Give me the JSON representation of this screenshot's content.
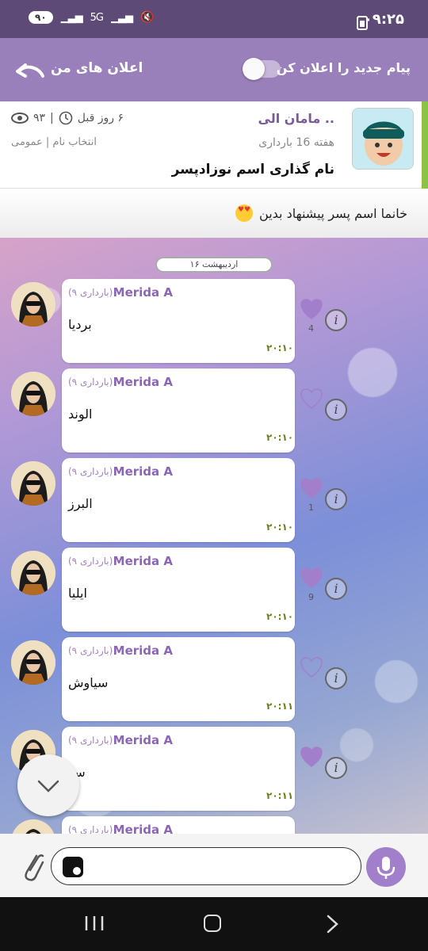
{
  "status_bar": {
    "time": "۰۹:۲۵",
    "left_pill": "۹۰",
    "network": "5G"
  },
  "header": {
    "my_ads": "اعلان های من",
    "notify_new": "پیام جدید را اعلان کن",
    "notify_toggle_on": false
  },
  "post": {
    "author": "مامان الی ..",
    "week": "هفته 16 بارداری",
    "title": "نام گذاری اسم نوزادپسر",
    "time_ago": "۶ روز قبل",
    "views": "۹۳",
    "category": "انتخاب نام | عمومی",
    "question": "خانما اسم پسر پیشنهاد بدین"
  },
  "date_separator": "۱۶ اردیبهشت",
  "messages": [
    {
      "name": "Merida A",
      "tag": "(۹ بارداری)",
      "text": "بردیا",
      "time": "۲۰:۱۰",
      "liked": true,
      "likes": "4"
    },
    {
      "name": "Merida A",
      "tag": "(۹ بارداری)",
      "text": "الوند",
      "time": "۲۰:۱۰",
      "liked": false,
      "likes": ""
    },
    {
      "name": "Merida A",
      "tag": "(۹ بارداری)",
      "text": "البرز",
      "time": "۲۰:۱۰",
      "liked": true,
      "likes": "1"
    },
    {
      "name": "Merida A",
      "tag": "(۹ بارداری)",
      "text": "ایلیا",
      "time": "۲۰:۱۰",
      "liked": true,
      "likes": "9"
    },
    {
      "name": "Merida A",
      "tag": "(۹ بارداری)",
      "text": "سیاوش",
      "time": "۲۰:۱۱",
      "liked": false,
      "likes": ""
    },
    {
      "name": "Merida A",
      "tag": "(۹ بارداری)",
      "text": "سو",
      "time": "۲۰:۱۱",
      "liked": true,
      "likes": ""
    },
    {
      "name": "Merida A",
      "tag": "(۹ بارداری)",
      "text": "",
      "time": "",
      "liked": false,
      "likes": ""
    }
  ],
  "input": {
    "placeholder": ""
  },
  "colors": {
    "accent": "#9a80bb",
    "status_bar": "#5e4a76",
    "heart": "#a27fcb",
    "time_text": "#6c7d1c"
  }
}
